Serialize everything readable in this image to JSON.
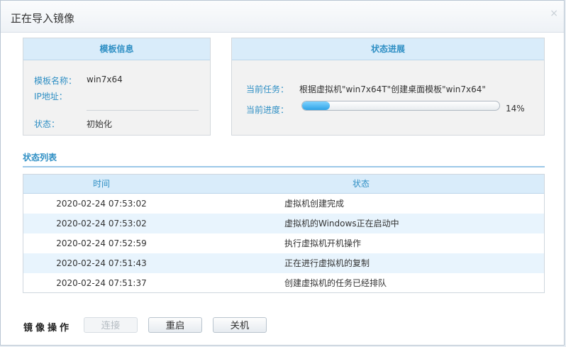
{
  "dialog": {
    "title": "正在导入镜像",
    "close_glyph": "×"
  },
  "template_info": {
    "header": "模板信息",
    "name_label": "模板名称：",
    "name_value": "win7x64",
    "ip_label": "IP地址：",
    "ip_value": "",
    "status_label": "状态：",
    "status_value": "初始化"
  },
  "progress_panel": {
    "header": "状态进展",
    "task_label": "当前任务：",
    "task_value": "根据虚拟机\"win7x64T\"创建桌面模板\"win7x64\"",
    "progress_label": "当前进度：",
    "progress_percent": 14,
    "progress_text": "14%"
  },
  "status_list": {
    "title": "状态列表",
    "columns": {
      "time": "时间",
      "status": "状态"
    },
    "rows": [
      {
        "time": "2020-02-24 07:53:02",
        "status": "虚拟机创建完成"
      },
      {
        "time": "2020-02-24 07:53:02",
        "status": "虚拟机的Windows正在启动中"
      },
      {
        "time": "2020-02-24 07:52:59",
        "status": "执行虚拟机开机操作"
      },
      {
        "time": "2020-02-24 07:51:43",
        "status": "正在进行虚拟机的复制"
      },
      {
        "time": "2020-02-24 07:51:37",
        "status": "创建虚拟机的任务已经排队"
      }
    ]
  },
  "operations": {
    "label": "镜像操作",
    "connect": "连接",
    "restart": "重启",
    "shutdown": "关机"
  },
  "colors": {
    "accent": "#2f8fc4",
    "header_bg": "#d9ecfa",
    "progress": "#2fa3e6"
  }
}
